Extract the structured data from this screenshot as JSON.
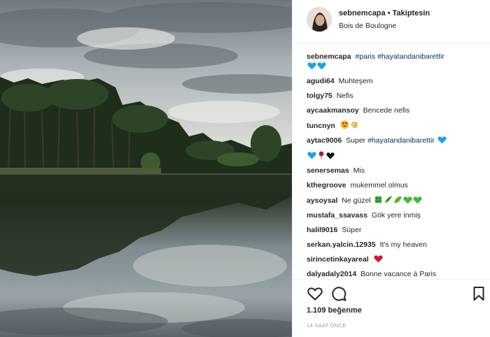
{
  "post": {
    "username": "sebnemcapa",
    "separator": "•",
    "follow_status": "Takiptesin",
    "location": "Bois de Boulogne"
  },
  "caption": {
    "username": "sebnemcapa",
    "hashtag_1": "#paris",
    "hashtag_2": "#hayatandanibarettir",
    "emojis": [
      "blue-heart",
      "blue-heart"
    ]
  },
  "comments": [
    {
      "user": "agudi64",
      "text": "Muhteşem"
    },
    {
      "user": "tolgy75",
      "text": "Nefis"
    },
    {
      "user": "aycaakmansoy",
      "text": "Bencede nefis"
    },
    {
      "user": "tuncnyn",
      "text": "",
      "emojis": [
        "heart-eyes-face",
        "ok-hand"
      ]
    },
    {
      "user": "aytac9006",
      "text": "Super",
      "hashtag": "#hayatandanibarettir",
      "emojis": [
        "blue-heart",
        "blue-heart",
        "rose",
        "black-heart"
      ]
    },
    {
      "user": "senersemas",
      "text": "Mis"
    },
    {
      "user": "kthegroove",
      "text": "mukemmel olmus"
    },
    {
      "user": "aysoysal",
      "text": "Ne güzel",
      "emojis": [
        "four-leaf-clover",
        "herb",
        "leaf",
        "green-heart",
        "green-heart"
      ]
    },
    {
      "user": "mustafa_ssavass",
      "text": "Gök yere inmiş"
    },
    {
      "user": "halil9016",
      "text": "Süper"
    },
    {
      "user": "serkan.yalcin.12935",
      "text": "It's my heaven"
    },
    {
      "user": "sirincetinkayareal",
      "text": "",
      "emojis": [
        "red-heart"
      ]
    },
    {
      "user": "dalyadaly2014",
      "text": "Bonne vacance à Paris"
    }
  ],
  "footer": {
    "likes": "1.109 beğenme",
    "time": "14 SAAT ÖNCE"
  },
  "colors": {
    "hashtag": "#003569",
    "blue_heart": "#1da1e6",
    "green_heart": "#3dbb3a",
    "red_heart": "#e0102a"
  },
  "icons": [
    "heart-outline-icon",
    "comment-bubble-icon",
    "bookmark-icon"
  ]
}
